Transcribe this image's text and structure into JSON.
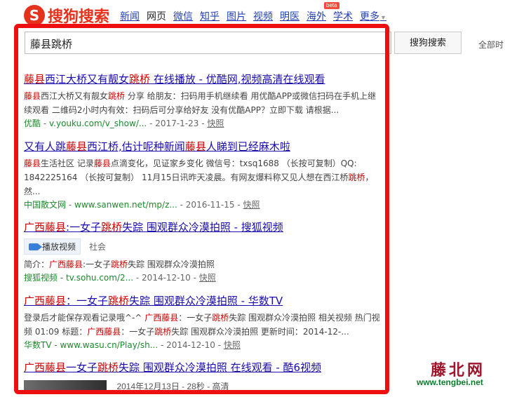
{
  "header": {
    "logo_mark": "S",
    "logo_text": "搜狗搜索",
    "nav": [
      {
        "label": "新闻",
        "active": false
      },
      {
        "label": "网页",
        "active": true
      },
      {
        "label": "微信",
        "active": false
      },
      {
        "label": "知乎",
        "active": false
      },
      {
        "label": "图片",
        "active": false
      },
      {
        "label": "视频",
        "active": false
      },
      {
        "label": "明医",
        "active": false
      },
      {
        "label": "海外",
        "active": false
      },
      {
        "label": "学术",
        "active": false
      }
    ],
    "more_label": "更多",
    "beta_label": "beta"
  },
  "search": {
    "query": "藤县跳桥",
    "button_label": "搜狗搜索",
    "time_filter": "全部时"
  },
  "results": [
    {
      "title_parts": [
        {
          "text": "藤县",
          "hl": true
        },
        {
          "text": "西江大桥又有靓女",
          "hl": false
        },
        {
          "text": "跳桥",
          "hl": true
        },
        {
          "text": "   在线播放 - 优酷网,视频高清在线观看",
          "hl": false
        }
      ],
      "snippet_parts": [
        {
          "text": "藤县",
          "hl": true
        },
        {
          "text": "西江大桥又有靓女",
          "hl": false
        },
        {
          "text": "跳桥",
          "hl": true
        },
        {
          "text": " 分享 给朋友：扫码用手机继续看 用优酷APP或微信扫码在手机上继续观看 二维码2小时内有效：扫码后可分享给好友 没有优酷APP？立即下载 请根据...",
          "hl": false
        }
      ],
      "cite_site": "优酷",
      "cite_url": "v.youku.com/v_show/...",
      "date": "2017-1-23",
      "snapshot": "快照"
    },
    {
      "title_parts": [
        {
          "text": "又有人跳",
          "hl": false
        },
        {
          "text": "藤县",
          "hl": true
        },
        {
          "text": "西江桥,估计呢种新闻",
          "hl": false
        },
        {
          "text": "藤县",
          "hl": true
        },
        {
          "text": "人睇到已经麻木啦",
          "hl": false
        }
      ],
      "snippet_parts": [
        {
          "text": "藤县",
          "hl": true
        },
        {
          "text": "生活社区 记录",
          "hl": false
        },
        {
          "text": "藤县",
          "hl": true
        },
        {
          "text": "点滴变化，见证家乡变化 微信号：txsq1688 （长按可复制）QQ: 1842225164 （长按可复制） 11月15日讯昨天凌晨。有网友爆料称又见人想在西江桥",
          "hl": false
        },
        {
          "text": "跳桥",
          "hl": true
        },
        {
          "text": "，然...",
          "hl": false
        }
      ],
      "cite_site": "中国散文网",
      "cite_url": "www.sanwen.net/mp/z...",
      "date": "2016-11-15",
      "snapshot": "快照"
    },
    {
      "title_parts": [
        {
          "text": "广西藤县",
          "hl": true
        },
        {
          "text": ":一女子",
          "hl": false
        },
        {
          "text": "跳桥",
          "hl": true
        },
        {
          "text": "失踪 围观群众冷漠拍照 - 搜狐视频",
          "hl": false
        }
      ],
      "play_label": "播放视频",
      "tag": "社会",
      "snippet_parts": [
        {
          "text": "简介：",
          "hl": false
        },
        {
          "text": "广西藤县",
          "hl": true
        },
        {
          "text": ":一女子",
          "hl": false
        },
        {
          "text": "跳桥",
          "hl": true
        },
        {
          "text": "失踪 围观群众冷漠拍照",
          "hl": false
        }
      ],
      "cite_site": "搜狐视频",
      "cite_url": "tv.sohu.com/2...",
      "date": "2014-12-10",
      "snapshot": "快照"
    },
    {
      "title_parts": [
        {
          "text": "广西藤县",
          "hl": true
        },
        {
          "text": "：一女子",
          "hl": false
        },
        {
          "text": "跳桥",
          "hl": true
        },
        {
          "text": "失踪 围观群众冷漠拍照 - 华数TV",
          "hl": false
        }
      ],
      "snippet_parts": [
        {
          "text": "登录后才能保存观看记录哦^-^ ",
          "hl": false
        },
        {
          "text": "广西藤县",
          "hl": true
        },
        {
          "text": "：一女子",
          "hl": false
        },
        {
          "text": "跳桥",
          "hl": true
        },
        {
          "text": "失踪 围观群众冷漠拍照 相关视频 热门视频 01:09 标题：",
          "hl": false
        },
        {
          "text": "广西藤县",
          "hl": true
        },
        {
          "text": "：一女子",
          "hl": false
        },
        {
          "text": "跳桥",
          "hl": true
        },
        {
          "text": "失踪 围观群众冷漠拍照 更新时间：2014-12-...",
          "hl": false
        }
      ],
      "cite_site": "华数TV",
      "cite_url": "www.wasu.cn/Play/sh...",
      "date": "2014-12-10",
      "snapshot": "快照"
    },
    {
      "title_parts": [
        {
          "text": "广西藤县",
          "hl": true
        },
        {
          "text": "一女子",
          "hl": false
        },
        {
          "text": "跳桥",
          "hl": true
        },
        {
          "text": "失踪 围观群众冷漠拍照 在线观看 - 酷6视频",
          "hl": false
        }
      ],
      "meta": "2014年12月13日 - 28秒 - 高清"
    }
  ],
  "watermark": {
    "title": "藤北网",
    "url": "www.tengbei.net"
  }
}
